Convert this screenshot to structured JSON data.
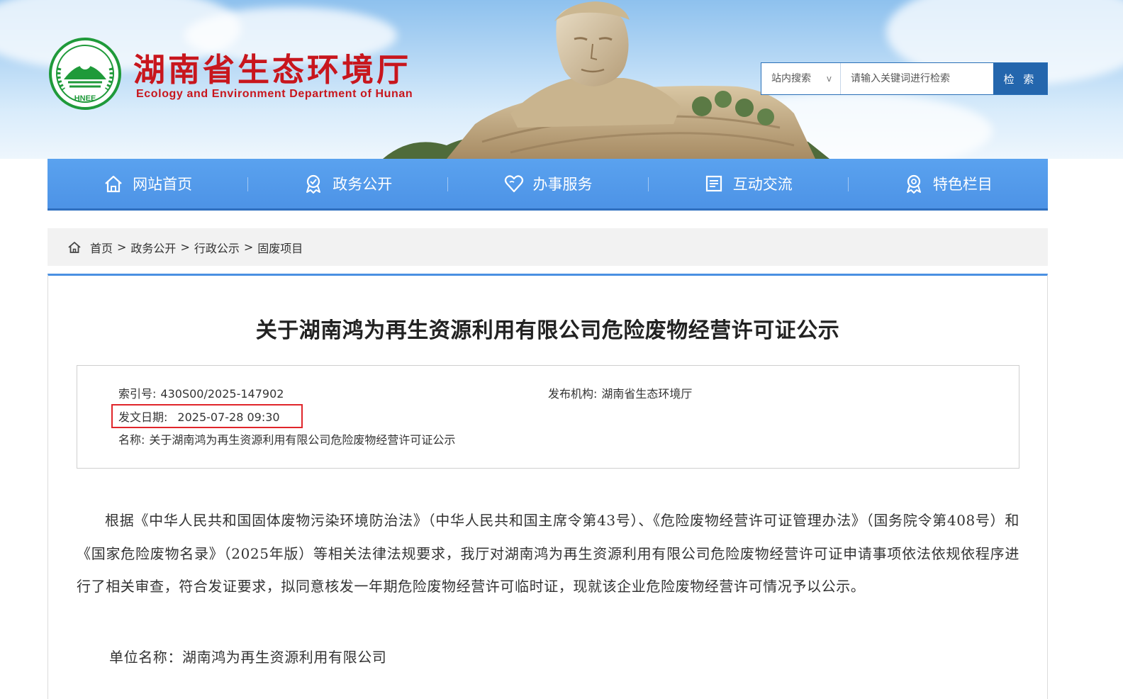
{
  "header": {
    "title_cn": "湖南省生态环境厅",
    "title_en": "Ecology and Environment Department of Hunan",
    "logo_text": "HNEE",
    "brand_color": "#c8161d"
  },
  "search": {
    "scope_label": "站内搜索",
    "scope_chevron": "v",
    "placeholder": "请输入关键词进行检索",
    "button_label": "检 索"
  },
  "nav": {
    "items": [
      {
        "label": "网站首页",
        "icon": "home-icon"
      },
      {
        "label": "政务公开",
        "icon": "badge-icon"
      },
      {
        "label": "办事服务",
        "icon": "heart-icon"
      },
      {
        "label": "互动交流",
        "icon": "document-icon"
      },
      {
        "label": "特色栏目",
        "icon": "badge-icon"
      }
    ],
    "color": "#5aa2ef"
  },
  "breadcrumb": {
    "items": [
      "首页",
      "政务公开",
      "行政公示",
      "固废项目"
    ],
    "separator": ">"
  },
  "article": {
    "title": "关于湖南鸿为再生资源利用有限公司危险废物经营许可证公示",
    "meta": {
      "index_label": "索引号:",
      "index_value": "430S00/2025-147902",
      "publisher_label": "发布机构:",
      "publisher_value": "湖南省生态环境厅",
      "date_label": "发文日期:",
      "date_value": "2025-07-28 09:30",
      "name_label": "名称:",
      "name_value": "关于湖南鸿为再生资源利用有限公司危险废物经营许可证公示"
    },
    "body": "根据《中华人民共和国固体废物污染环境防治法》（中华人民共和国主席令第43号）、《危险废物经营许可证管理办法》（国务院令第408号）和《国家危险废物名录》（2025年版）等相关法律法规要求，我厅对湖南鸿为再生资源利用有限公司危险废物经营许可证申请事项依法依规依程序进行了相关审查，符合发证要求，拟同意核发一年期危险废物经营许可临时证，现就该企业危险废物经营许可情况予以公示。",
    "unit_line": "单位名称：湖南鸿为再生资源利用有限公司",
    "highlight_color": "#e0262b"
  }
}
